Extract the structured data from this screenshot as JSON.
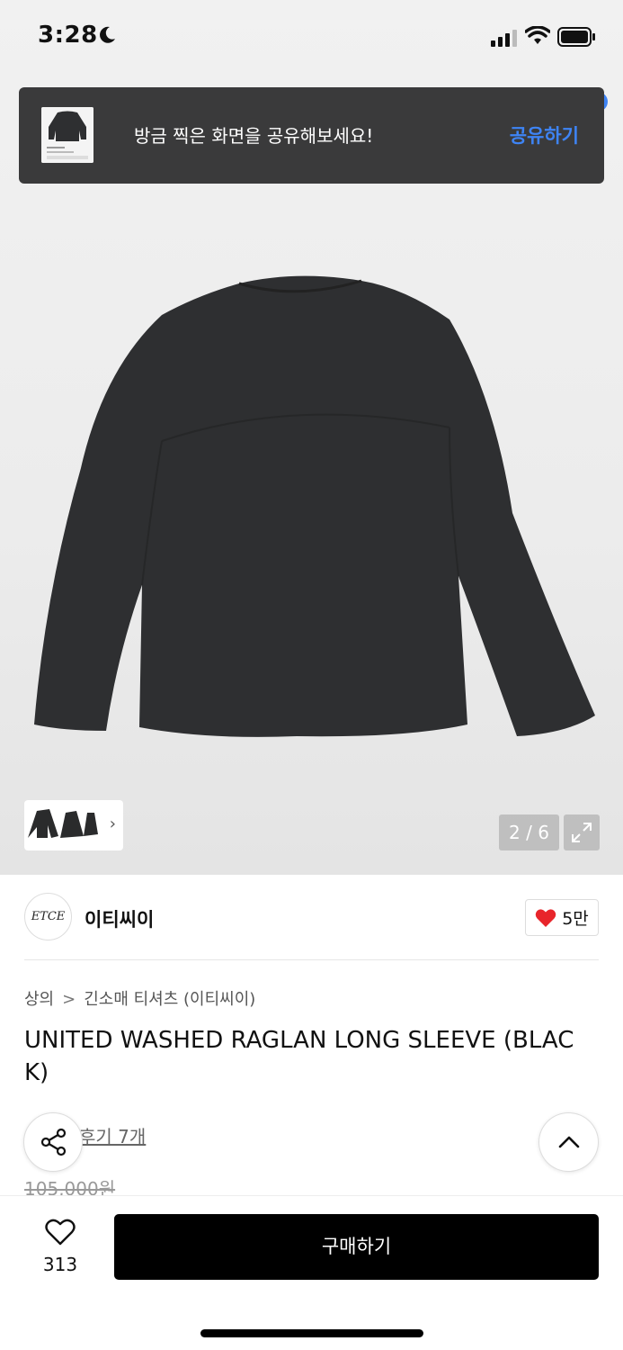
{
  "status_bar": {
    "time": "3:28"
  },
  "toast": {
    "message": "방금 찍은 화면을 공유해보세요!",
    "action_label": "공유하기"
  },
  "gallery": {
    "pager": "2 / 6"
  },
  "brand": {
    "logo_text": "ETCE",
    "name": "이티씨이",
    "likes": "5만"
  },
  "breadcrumb": {
    "category": "상의",
    "separator": ">",
    "subcategory": "긴소매 티셔츠 (이티씨이)"
  },
  "product": {
    "title": "UNITED WASHED RAGLAN LONG SLEEVE (BLACK)",
    "reviews_label": "후기 7개",
    "price": "105,000원"
  },
  "bottom_bar": {
    "wish_count": "313",
    "buy_label": "구매하기"
  },
  "colors": {
    "accent": "#3e84f5",
    "toast_bg": "#3a3a3b",
    "buy_bg": "#000000",
    "heart": "#e8252b"
  },
  "icons": [
    "moon-icon",
    "signal-icon",
    "wifi-icon",
    "battery-icon",
    "chevron-right-icon",
    "expand-icon",
    "heart-filled-icon",
    "share-icon",
    "chevron-up-icon",
    "heart-outline-icon"
  ]
}
